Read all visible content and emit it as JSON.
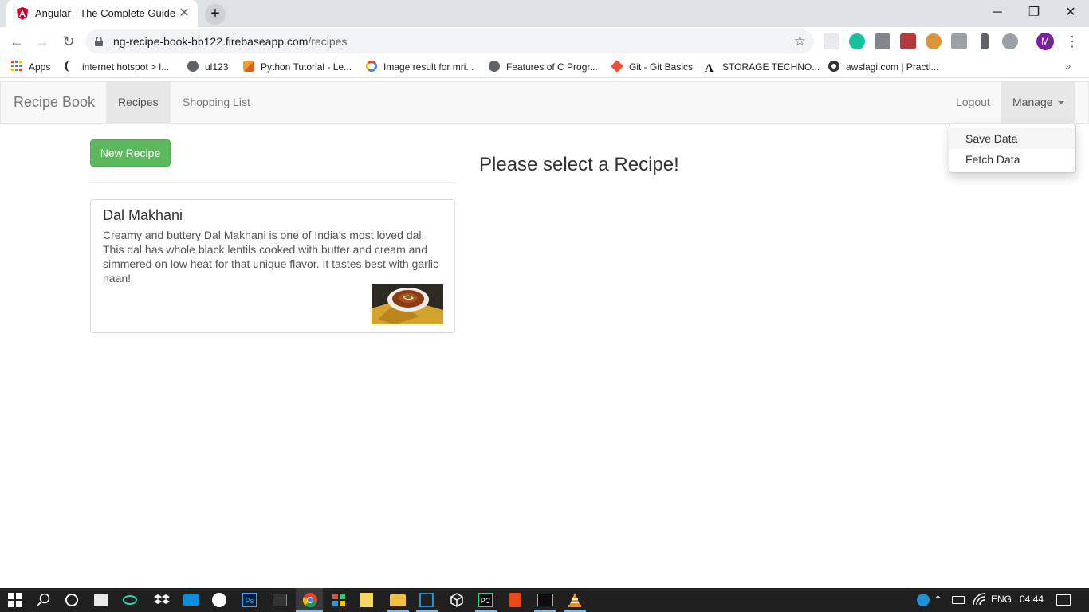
{
  "browser": {
    "tab_title": "Angular - The Complete Guide",
    "url_host": "ng-recipe-book-bb122.firebaseapp.com",
    "url_path": "/recipes",
    "avatar_letter": "M",
    "close_glyph": "✕",
    "newtab_glyph": "+",
    "back_glyph": "←",
    "forward_glyph": "→",
    "reload_glyph": "↻",
    "star_glyph": "☆",
    "menu_glyph": "⋮",
    "minimize_glyph": "─",
    "restore_glyph": "❐",
    "win_close_glyph": "✕",
    "more_bookmarks": "»"
  },
  "bookmarks": [
    {
      "label": "Apps",
      "icon": "apps-grid-icon"
    },
    {
      "label": "internet hotspot > l...",
      "icon": "moon-icon"
    },
    {
      "label": "ul123",
      "icon": "globe-icon"
    },
    {
      "label": "Python Tutorial - Le...",
      "icon": "python-icon"
    },
    {
      "label": "Image result for mri...",
      "icon": "google-icon"
    },
    {
      "label": "Features of C Progr...",
      "icon": "globe-icon"
    },
    {
      "label": "Git - Git Basics",
      "icon": "git-icon"
    },
    {
      "label": "STORAGE TECHNO...",
      "icon": "font-a-icon"
    },
    {
      "label": "awslagi.com | Practi...",
      "icon": "circle-icon"
    }
  ],
  "navbar": {
    "brand": "Recipe Book",
    "links": [
      "Recipes",
      "Shopping List"
    ],
    "logout": "Logout",
    "manage": "Manage",
    "dropdown": [
      "Save Data",
      "Fetch Data"
    ]
  },
  "main": {
    "new_recipe_button": "New Recipe",
    "select_message": "Please select a Recipe!",
    "recipes": [
      {
        "name": "Dal Makhani",
        "description": "Creamy and buttery Dal Makhani is one of India's most loved dal! This dal has whole black lentils cooked with butter and cream and simmered on low heat for that unique flavor. It tastes best with garlic naan!"
      }
    ]
  },
  "taskbar": {
    "language": "ENG",
    "time": "04:44"
  },
  "colors": {
    "success_green": "#5cb85c",
    "navbar_bg": "#f8f8f8",
    "taskbar_bg": "#202020",
    "angular_red": "#dd0031",
    "avatar_purple": "#7b1fa2"
  }
}
